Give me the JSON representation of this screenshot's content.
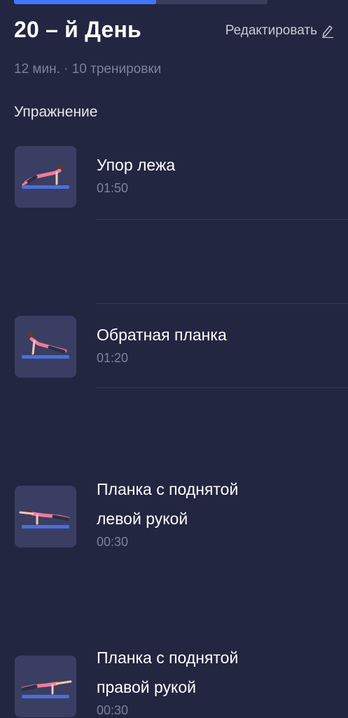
{
  "workout": {
    "progress_fraction": 0.56,
    "day_title": "20 – й День",
    "edit_label": "Редактировать",
    "summary": "12 мин. · 10 тренировки",
    "section_title": "Упражнение"
  },
  "exercises": [
    {
      "name_lines": [
        "Упор лежа"
      ],
      "time": "01:50"
    },
    {
      "name_lines": [
        "Обратная планка"
      ],
      "time": "01:20"
    },
    {
      "name_lines": [
        "Планка с поднятой",
        "левой рукой"
      ],
      "time": "00:30"
    },
    {
      "name_lines": [
        "Планка с поднятой",
        "правой рукой"
      ],
      "time": "00:30"
    }
  ],
  "colors": {
    "background": "#232640",
    "accent": "#3f78ff",
    "muted_text": "#7d8199",
    "thumb_bg": "#3a3e63"
  }
}
